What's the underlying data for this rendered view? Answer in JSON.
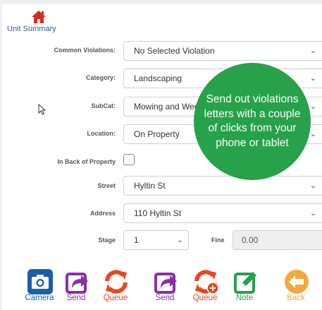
{
  "header": {
    "home_label": "Unit Summary"
  },
  "form": {
    "common_violations": {
      "label": "Common Violations:",
      "value": "No Selected Violation"
    },
    "category": {
      "label": "Category:",
      "value": "Landscaping"
    },
    "subcat": {
      "label": "SubCat:",
      "value": "Mowing and Weeds"
    },
    "location": {
      "label": "Location:",
      "value": "On Property"
    },
    "back_of_property": {
      "label": "In Back of Property",
      "checked": false
    },
    "street": {
      "label": "Street",
      "value": "Hyltin St"
    },
    "address": {
      "label": "Address",
      "value": "110 Hyltin St"
    },
    "stage": {
      "label": "Stage",
      "value": "1"
    },
    "fine": {
      "label": "Fine",
      "value": "0.00"
    }
  },
  "promo_bubble": {
    "text": "Send out violations letters with a couple of clicks from your phone or tablet"
  },
  "toolbar": {
    "camera": "Camera",
    "send": "Send",
    "queue": "Queue",
    "send2": "Send",
    "queue2": "Queue",
    "note": "Note",
    "back": "Back"
  },
  "colors": {
    "purple": "#8b2fa6",
    "orange_red": "#e8471f",
    "green": "#27a14a",
    "camera_blue": "#1b5fa8",
    "back_orange": "#f3a83d",
    "label_blue": "#35579b"
  }
}
